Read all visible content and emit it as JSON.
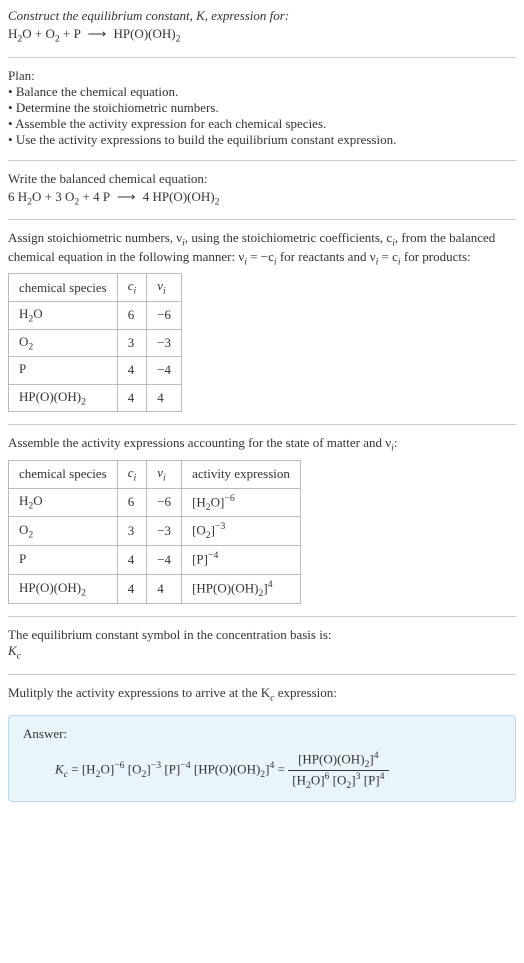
{
  "intro": {
    "line1": "Construct the equilibrium constant, K, expression for:",
    "equation_lhs1": "H",
    "equation_lhs1_sub": "2",
    "equation_lhs2": "O + O",
    "equation_lhs2_sub": "2",
    "equation_lhs3": " + P",
    "arrow": "⟶",
    "equation_rhs": "HP(O)(OH)",
    "equation_rhs_sub": "2"
  },
  "plan": {
    "title": "Plan:",
    "items": [
      "Balance the chemical equation.",
      "Determine the stoichiometric numbers.",
      "Assemble the activity expression for each chemical species.",
      "Use the activity expressions to build the equilibrium constant expression."
    ]
  },
  "balanced": {
    "title": "Write the balanced chemical equation:",
    "c1": "6 H",
    "c1sub": "2",
    "c2": "O + 3 O",
    "c2sub": "2",
    "c3": " + 4 P",
    "arrow": "⟶",
    "c4": "4 HP(O)(OH)",
    "c4sub": "2"
  },
  "stoich": {
    "intro_a": "Assign stoichiometric numbers, ν",
    "intro_a_sub": "i",
    "intro_b": ", using the stoichiometric coefficients, c",
    "intro_b_sub": "i",
    "intro_c": ", from the balanced chemical equation in the following manner: ν",
    "intro_c_sub": "i",
    "intro_d": " = −c",
    "intro_d_sub": "i",
    "intro_e": " for reactants and ν",
    "intro_e_sub": "i",
    "intro_f": " = c",
    "intro_f_sub": "i",
    "intro_g": " for products:",
    "headers": {
      "species": "chemical species",
      "ci": "c",
      "ci_sub": "i",
      "vi": "ν",
      "vi_sub": "i"
    },
    "rows": [
      {
        "sp1": "H",
        "sp1sub": "2",
        "sp2": "O",
        "ci": "6",
        "vi": "−6"
      },
      {
        "sp1": "O",
        "sp1sub": "2",
        "sp2": "",
        "ci": "3",
        "vi": "−3"
      },
      {
        "sp1": "P",
        "sp1sub": "",
        "sp2": "",
        "ci": "4",
        "vi": "−4"
      },
      {
        "sp1": "HP(O)(OH)",
        "sp1sub": "2",
        "sp2": "",
        "ci": "4",
        "vi": "4"
      }
    ]
  },
  "activity": {
    "intro_a": "Assemble the activity expressions accounting for the state of matter and ν",
    "intro_a_sub": "i",
    "intro_b": ":",
    "headers": {
      "species": "chemical species",
      "ci": "c",
      "ci_sub": "i",
      "vi": "ν",
      "vi_sub": "i",
      "act": "activity expression"
    },
    "rows": [
      {
        "sp1": "H",
        "sp1sub": "2",
        "sp2": "O",
        "ci": "6",
        "vi": "−6",
        "ae1": "[H",
        "ae1sub": "2",
        "ae2": "O]",
        "aesup": "−6"
      },
      {
        "sp1": "O",
        "sp1sub": "2",
        "sp2": "",
        "ci": "3",
        "vi": "−3",
        "ae1": "[O",
        "ae1sub": "2",
        "ae2": "]",
        "aesup": "−3"
      },
      {
        "sp1": "P",
        "sp1sub": "",
        "sp2": "",
        "ci": "4",
        "vi": "−4",
        "ae1": "[P]",
        "ae1sub": "",
        "ae2": "",
        "aesup": "−4"
      },
      {
        "sp1": "HP(O)(OH)",
        "sp1sub": "2",
        "sp2": "",
        "ci": "4",
        "vi": "4",
        "ae1": "[HP(O)(OH)",
        "ae1sub": "2",
        "ae2": "]",
        "aesup": "4"
      }
    ]
  },
  "symbol": {
    "line": "The equilibrium constant symbol in the concentration basis is:",
    "kc": "K",
    "kc_sub": "c"
  },
  "multiply": {
    "line_a": "Mulitply the activity expressions to arrive at the K",
    "line_a_sub": "c",
    "line_b": " expression:"
  },
  "answer": {
    "label": "Answer:",
    "kc": "K",
    "kc_sub": "c",
    "eq": " = ",
    "t1a": "[H",
    "t1sub": "2",
    "t1b": "O]",
    "t1sup": "−6",
    "t2a": " [O",
    "t2sub": "2",
    "t2b": "]",
    "t2sup": "−3",
    "t3a": " [P]",
    "t3sup": "−4",
    "t4a": " [HP(O)(OH)",
    "t4sub": "2",
    "t4b": "]",
    "t4sup": "4",
    "eq2": " = ",
    "num_a": "[HP(O)(OH)",
    "num_sub": "2",
    "num_b": "]",
    "num_sup": "4",
    "den1a": "[H",
    "den1sub": "2",
    "den1b": "O]",
    "den1sup": "6",
    "den2a": " [O",
    "den2sub": "2",
    "den2b": "]",
    "den2sup": "3",
    "den3a": " [P]",
    "den3sup": "4"
  }
}
